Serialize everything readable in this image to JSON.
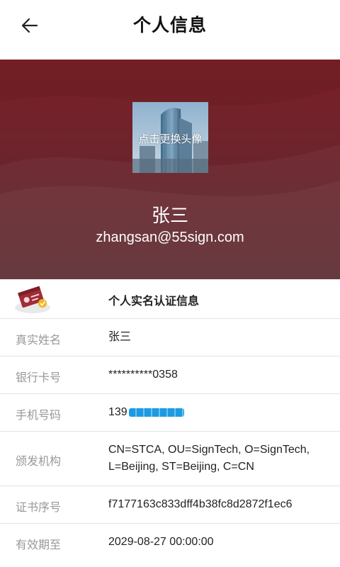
{
  "header": {
    "title": "个人信息"
  },
  "profile": {
    "avatar_hint": "点击更换头像",
    "name": "张三",
    "email": "zhangsan@55sign.com"
  },
  "section": {
    "title": "个人实名认证信息"
  },
  "fields": [
    {
      "label": "真实姓名",
      "value": "张三"
    },
    {
      "label": "银行卡号",
      "value": "**********0358"
    },
    {
      "label": "手机号码",
      "value": "139"
    },
    {
      "label": "颁发机构",
      "value_line1": "CN=STCA, OU=SignTech, O=SignTech,",
      "value_line2": "L=Beijing, ST=Beijing, C=CN"
    },
    {
      "label": "证书序号",
      "value": "f7177163c833dff4b38fc8d2872f1ec6"
    },
    {
      "label": "有效期至",
      "value": "2029-08-27 00:00:00"
    }
  ],
  "colors": {
    "hero": "#7b1f27",
    "mask": "#1d9be2"
  }
}
